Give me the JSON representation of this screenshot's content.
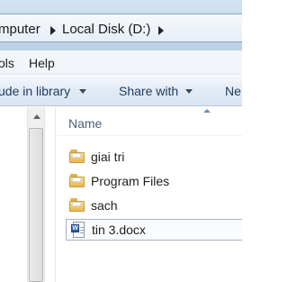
{
  "address_bar": {
    "crumbs": [
      "mputer",
      "Local Disk (D:)"
    ]
  },
  "menu_bar": {
    "items": [
      "ols",
      "Help"
    ]
  },
  "command_bar": {
    "items": [
      {
        "label": "ude in library"
      },
      {
        "label": "Share with"
      },
      {
        "label": "Ne"
      }
    ]
  },
  "file_list": {
    "column_header": "Name",
    "items": [
      {
        "name": "giai tri",
        "type": "folder",
        "icon": "folder-icon"
      },
      {
        "name": "Program Files",
        "type": "folder",
        "icon": "folder-icon"
      },
      {
        "name": "sach",
        "type": "folder",
        "icon": "folder-icon"
      },
      {
        "name": "tin 3.docx",
        "type": "document",
        "icon": "word-document-icon",
        "selected": true
      }
    ]
  },
  "colors": {
    "address_bar_bg": "#c4d7ea",
    "command_bar_text": "#1e3a5c",
    "header_text": "#4c607a",
    "folder": "#e8b64e",
    "word_badge": "#2b5ea8"
  }
}
